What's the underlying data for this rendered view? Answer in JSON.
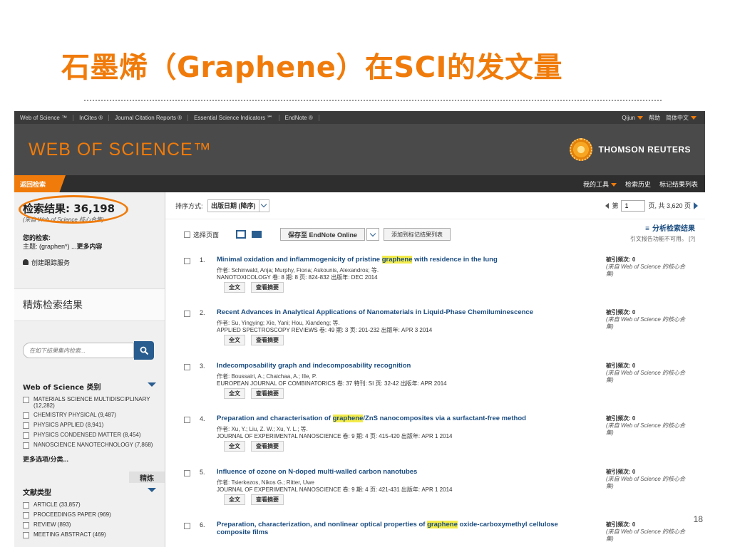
{
  "slide": {
    "title": "石墨烯（Graphene）在SCI的发文量",
    "page_number": "18"
  },
  "top_nav": {
    "links": [
      "Web of Science ™",
      "InCites ®",
      "Journal Citation Reports ®",
      "Essential Science Indicators ℠",
      "EndNote ®"
    ],
    "user": "Qijun",
    "help": "帮助",
    "language": "简体中文"
  },
  "banner": {
    "logo": "WEB OF SCIENCE™",
    "publisher": "THOMSON REUTERS"
  },
  "toolbar": {
    "back": "返回检索",
    "my_tools": "我的工具",
    "search_history": "检索历史",
    "marked_list": "标记结果列表"
  },
  "sidebar": {
    "results_label": "检索结果: 36,198",
    "results_note": "(来自 Web of Science 核心合集)",
    "your_search": "您的检索:",
    "topic": "主题: (graphen*) ...",
    "more": "更多内容",
    "create_alert": "创建跟踪服务",
    "refine_title": "精炼检索结果",
    "search_placeholder": "在如下结果集内检索...",
    "category_title": "Web of Science 类别",
    "categories": [
      "MATERIALS SCIENCE MULTIDISCIPLINARY (12,282)",
      "CHEMISTRY PHYSICAL (9,487)",
      "PHYSICS APPLIED (8,941)",
      "PHYSICS CONDENSED MATTER (8,454)",
      "NANOSCIENCE NANOTECHNOLOGY (7,868)"
    ],
    "more_options": "更多选项/分类...",
    "refine_button": "精炼",
    "doc_type_title": "文献类型",
    "doc_types": [
      "ARTICLE (33,857)",
      "PROCEEDINGS PAPER (969)",
      "REVIEW (893)",
      "MEETING ABSTRACT (469)"
    ]
  },
  "main": {
    "sort_label": "排序方式:",
    "sort_value": "出版日期 (降序)",
    "page_prefix": "第",
    "page_value": "1",
    "page_suffix": "页, 共 3,620 页",
    "select_page": "选择页面",
    "save_endnote": "保存至 EndNote Online",
    "add_marked": "添加到标记结果列表",
    "analyze": "分析检索结果",
    "citation_report": "引文报告功能不可用。 [?]",
    "fulltext_label": "全文",
    "abstract_label": "查看摘要",
    "cited_label": "被引频次: 0",
    "cited_note": "(来自 Web of Science 的核心合集)",
    "records": [
      {
        "num": "1.",
        "title_pre": "Minimal oxidation and inflammogenicity of pristine ",
        "title_hl": "graphene",
        "title_post": " with residence in the lung",
        "authors": "作者: Schinwald, Anja; Murphy, Fiona; Askounis, Alexandros; 等.",
        "source": "NANOTOXICOLOGY 卷: 8 期: 8 页: 824-832 出版年: DEC 2014"
      },
      {
        "num": "2.",
        "title_pre": "Recent Advances in Analytical Applications of Nanomaterials in Liquid-Phase Chemiluminescence",
        "title_hl": "",
        "title_post": "",
        "authors": "作者: Su, Yingying; Xie, Yani; Hou, Xiandeng; 等.",
        "source": "APPLIED SPECTROSCOPY REVIEWS 卷: 49 期: 3 页: 201-232 出版年: APR 3 2014"
      },
      {
        "num": "3.",
        "title_pre": "Indecomposability graph and indecomposability recognition",
        "title_hl": "",
        "title_post": "",
        "authors": "作者: Boussairi, A.; Chaichaa, A.; Ille, P.",
        "source": "EUROPEAN JOURNAL OF COMBINATORICS 卷: 37 特刊: SI 页: 32-42 出版年: APR 2014"
      },
      {
        "num": "4.",
        "title_pre": "Preparation and characterisation of ",
        "title_hl": "graphene",
        "title_post": "/ZnS nanocomposites via a surfactant-free method",
        "authors": "作者: Xu, Y.; Liu, Z. W.; Xu, Y. L.; 等.",
        "source": "JOURNAL OF EXPERIMENTAL NANOSCIENCE 卷: 9 期: 4 页: 415-420 出版年: APR 1 2014"
      },
      {
        "num": "5.",
        "title_pre": "Influence of ozone on N-doped multi-walled carbon nanotubes",
        "title_hl": "",
        "title_post": "",
        "authors": "作者: Tsierkezos, Nikos G.; Ritter, Uwe",
        "source": "JOURNAL OF EXPERIMENTAL NANOSCIENCE 卷: 9 期: 4 页: 421-431 出版年: APR 1 2014"
      },
      {
        "num": "6.",
        "title_pre": "Preparation, characterization, and nonlinear optical properties of ",
        "title_hl": "graphene",
        "title_post": " oxide-carboxymethyl cellulose composite films",
        "authors": "",
        "source": ""
      }
    ]
  }
}
